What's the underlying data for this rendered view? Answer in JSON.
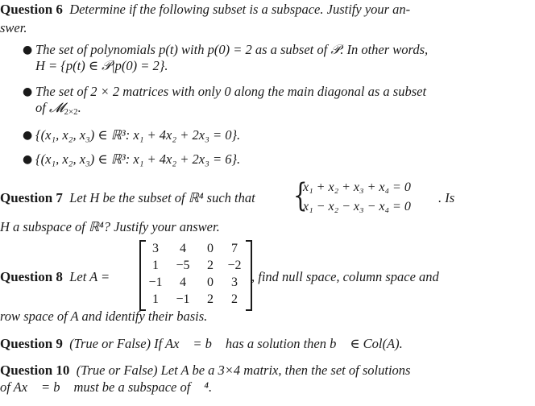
{
  "q6": {
    "label": "Question 6",
    "prompt_line1": "Determine if the following subset is a subspace. Justify your an-",
    "prompt_line2": "swer.",
    "items": [
      {
        "line1": "The set of polynomials p(t) with p(0) = 2 as a subset of 𝒫. In other words,",
        "line2": "H = {p(t) ∈ 𝒫|p(0) = 2}."
      },
      {
        "line1": "The set of 2 × 2 matrices with only 0 along the main diagonal as a subset",
        "line2_pre": "of ",
        "line2_sym": "𝓜",
        "line2_sub": "2×2",
        "line2_post": "."
      },
      {
        "pre": "{(x",
        "text": "{(x₁, x₂, x₃) ∈ ℝ³: x₁ + 4x₂ + 2x₃ = 0}."
      },
      {
        "text": "{(x₁, x₂, x₃) ∈ ℝ³: x₁ + 4x₂ + 2x₃ = 6}."
      }
    ]
  },
  "q7": {
    "label": "Question 7",
    "prompt_pre": "Let H be the subset of ℝ⁴ such that",
    "system": [
      "x₁ + x₂ + x₃ + x₄ = 0",
      "x₁ − x₂ − x₃ − x₄ = 0"
    ],
    "prompt_post": ".  Is",
    "line2": "H a subspace of ℝ⁴? Justify your answer."
  },
  "q8": {
    "label": "Question 8",
    "prompt_pre": "Let A =",
    "matrix": [
      [
        "3",
        "4",
        "0",
        "7"
      ],
      [
        "1",
        "−5",
        "2",
        "−2"
      ],
      [
        "−1",
        "4",
        "0",
        "3"
      ],
      [
        "1",
        "−1",
        "2",
        "2"
      ]
    ],
    "prompt_post": ", find null space, column space and",
    "line2": "row space of A and identify their basis."
  },
  "q9": {
    "label": "Question 9",
    "text": "(True or False) If Ax⃗ = b⃗ has a solution then b⃗ ∈ Col(A)."
  },
  "q10": {
    "label": "Question 10",
    "line1": "(True or False) Let A be a 3×4 matrix, then the set of solutions",
    "line2": "of Ax⃗ = b⃗ must be a subspace of ℝ⁴."
  }
}
